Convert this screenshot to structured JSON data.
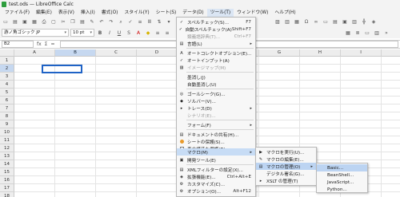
{
  "window": {
    "title": "test.ods — LibreOffice Calc"
  },
  "menubar": [
    "ファイル(F)",
    "編集(E)",
    "表示(V)",
    "挿入(I)",
    "書式(O)",
    "スタイル(Y)",
    "シート(S)",
    "データ(D)",
    "ツール(T)",
    "ウィンドウ(W)",
    "ヘルプ(H)"
  ],
  "toolbar": {
    "font_name": "游ノ角ゴシック JP",
    "font_size": "10 pt"
  },
  "formula": {
    "name_box": "B2",
    "fx": "fx",
    "sigma": "Σ",
    "equals": "="
  },
  "sheet": {
    "columns": [
      "A",
      "B",
      "C",
      "D",
      "E",
      "F",
      "G",
      "H",
      "I",
      "J"
    ],
    "rows": [
      "1",
      "2",
      "3",
      "4",
      "5",
      "6",
      "7",
      "8",
      "9",
      "10",
      "11",
      "12",
      "13",
      "14",
      "15",
      "16",
      "17",
      "18"
    ]
  },
  "tools_menu": {
    "items": [
      {
        "label": "スペルチェック(S)...",
        "shortcut": "F7"
      },
      {
        "label": "自動スペルチェック(A)",
        "shortcut": "Shift+F7"
      },
      {
        "label": "類義語辞典(T)...",
        "shortcut": "Ctrl+F7"
      },
      {
        "label": "言語(L)"
      },
      {
        "label": "オートコレクトオプション(E)..."
      },
      {
        "label": "オートインプット(A)"
      },
      {
        "label": "イメージマップ(M)"
      },
      {
        "label": "墨消し(J)"
      },
      {
        "label": "自動墨消し(U)"
      },
      {
        "label": "ゴールシーク(G)..."
      },
      {
        "label": "ソルバー(V)..."
      },
      {
        "label": "トレース(D)"
      },
      {
        "label": "シナリオ(E)..."
      },
      {
        "label": "フォーム(F)"
      },
      {
        "label": "ドキュメントの共有(H)..."
      },
      {
        "label": "シートの保護(S)..."
      },
      {
        "label": "表の構造を保護(D)..."
      },
      {
        "label": "マクロ(M)"
      },
      {
        "label": "開発ツール(E)"
      },
      {
        "label": "XMLフィルターの設定(X)..."
      },
      {
        "label": "拡張機能(E)...",
        "shortcut": "Ctrl+Alt+E"
      },
      {
        "label": "カスタマイズ(C)..."
      },
      {
        "label": "オプション(O)...",
        "shortcut": "Alt+F12"
      }
    ]
  },
  "macros_menu": {
    "items": [
      {
        "label": "マクロを実行(U)..."
      },
      {
        "label": "マクロの編集(E)..."
      },
      {
        "label": "マクロの管理(O)"
      },
      {
        "label": "デジタル署名(G)..."
      },
      {
        "label": "XSLT の管理(T)"
      }
    ]
  },
  "manage_menu": {
    "items": [
      {
        "label": "Basic..."
      },
      {
        "label": "BeanShell..."
      },
      {
        "label": "JavaScript..."
      },
      {
        "label": "Python..."
      }
    ]
  },
  "colors": {
    "selection": "#1f63c6",
    "highlight": "#c7dcf5",
    "menubar_active": "#dbe6f4"
  }
}
